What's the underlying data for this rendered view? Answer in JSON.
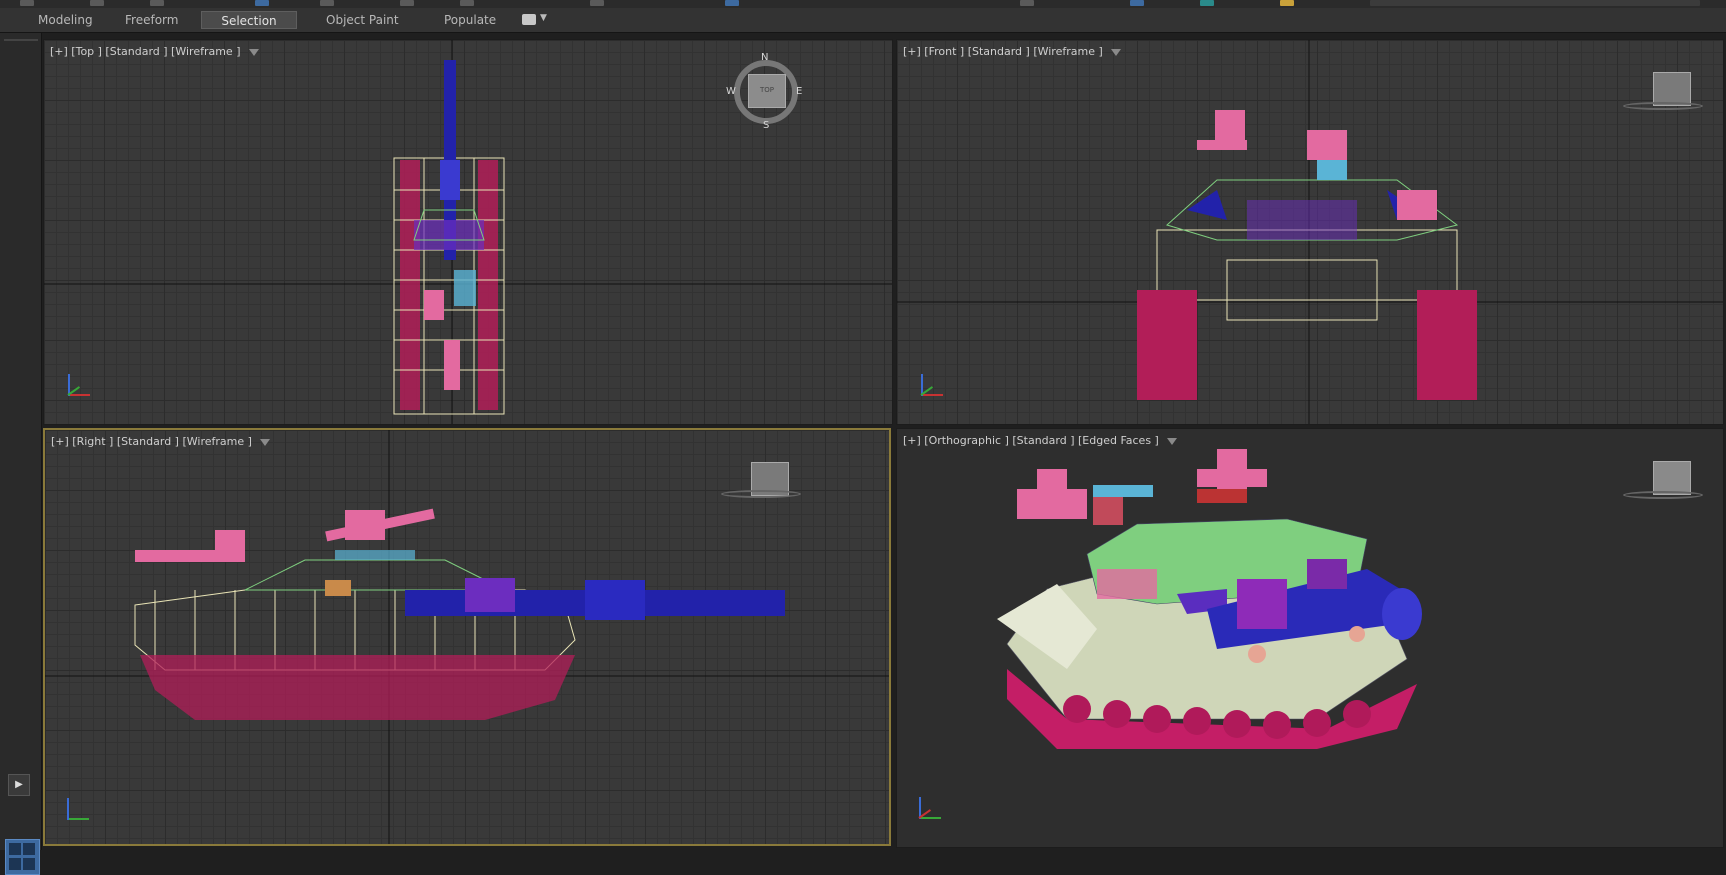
{
  "ribbon": {
    "tabs": [
      {
        "label": "Modeling",
        "active": false
      },
      {
        "label": "Freeform",
        "active": false
      },
      {
        "label": "Selection",
        "active": true
      },
      {
        "label": "Object Paint",
        "active": false
      },
      {
        "label": "Populate",
        "active": false
      }
    ]
  },
  "viewports": {
    "top": {
      "label": "[+] [Top ] [Standard ] [Wireframe ]"
    },
    "front": {
      "label": "[+] [Front ] [Standard ] [Wireframe ]"
    },
    "right": {
      "label": "[+] [Right ] [Standard ] [Wireframe ]"
    },
    "persp": {
      "label": "[+] [Orthographic ] [Standard ] [Edged Faces ]"
    }
  },
  "viewcube": {
    "top_face": "TOP",
    "compass": {
      "n": "N",
      "s": "S",
      "e": "E",
      "w": "W"
    }
  },
  "colors": {
    "hull_wire": "#e9e4b6",
    "tracks": "#c2255c",
    "gun_barrel": "#2222aa",
    "turret": "#7fcf7f",
    "mg_pink": "#e36aa0",
    "accent_purple": "#8e2bb8",
    "accent_cyan": "#5ab4d6",
    "active_border": "#8a7a3a"
  },
  "icons": [
    "play-icon",
    "viewport-layout-icon",
    "filter-icon",
    "viewcube-icon",
    "axis-tripod-icon"
  ]
}
